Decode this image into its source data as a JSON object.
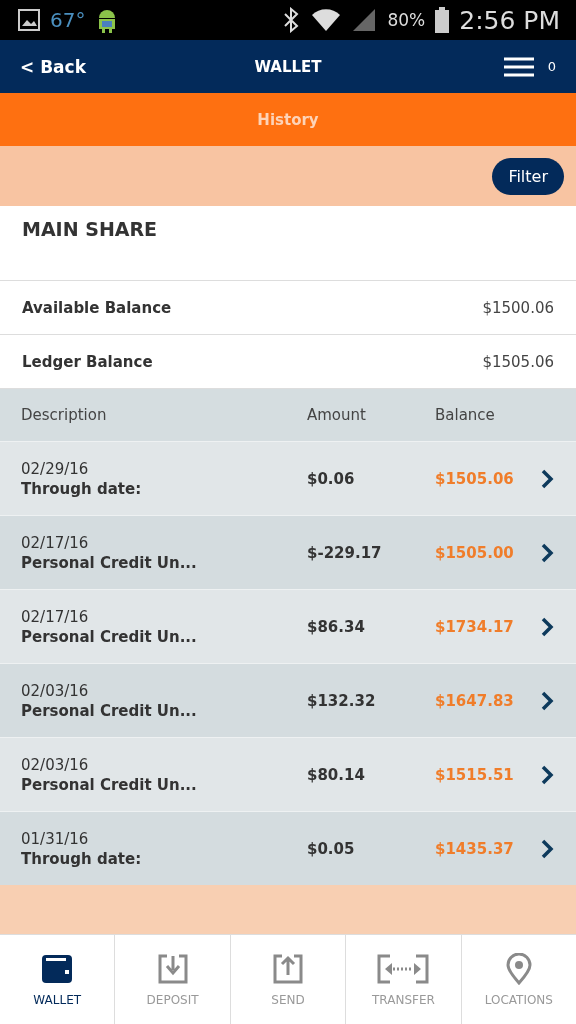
{
  "status_bar": {
    "temperature": "67°",
    "battery": "80%",
    "time": "2:56 PM"
  },
  "nav": {
    "back": "< Back",
    "title": "WALLET",
    "count": "0"
  },
  "section": {
    "title": "History"
  },
  "filter": {
    "label": "Filter"
  },
  "account": {
    "name": "MAIN SHARE",
    "balances": [
      {
        "label": "Available Balance",
        "value": "$1500.06"
      },
      {
        "label": "Ledger Balance",
        "value": "$1505.06"
      }
    ]
  },
  "table": {
    "columns": [
      "Description",
      "Amount",
      "Balance"
    ],
    "rows": [
      {
        "date": "02/29/16",
        "description": "Through date:",
        "amount": "$0.06",
        "balance": "$1505.06"
      },
      {
        "date": "02/17/16",
        "description": "Personal Credit Un...",
        "amount": "$-229.17",
        "balance": "$1505.00"
      },
      {
        "date": "02/17/16",
        "description": "Personal Credit Un...",
        "amount": "$86.34",
        "balance": "$1734.17"
      },
      {
        "date": "02/03/16",
        "description": "Personal Credit Un...",
        "amount": "$132.32",
        "balance": "$1647.83"
      },
      {
        "date": "02/03/16",
        "description": "Personal Credit Un...",
        "amount": "$80.14",
        "balance": "$1515.51"
      },
      {
        "date": "01/31/16",
        "description": "Through date:",
        "amount": "$0.05",
        "balance": "$1435.37"
      }
    ]
  },
  "tab_bar": [
    {
      "label": "WALLET",
      "kind": "wallet",
      "selected": true
    },
    {
      "label": "DEPOSIT",
      "kind": "deposit",
      "selected": false
    },
    {
      "label": "SEND",
      "kind": "send",
      "selected": false
    },
    {
      "label": "TRANSFER",
      "kind": "transfer",
      "selected": false
    },
    {
      "label": "LOCATIONS",
      "kind": "locations",
      "selected": false
    }
  ]
}
